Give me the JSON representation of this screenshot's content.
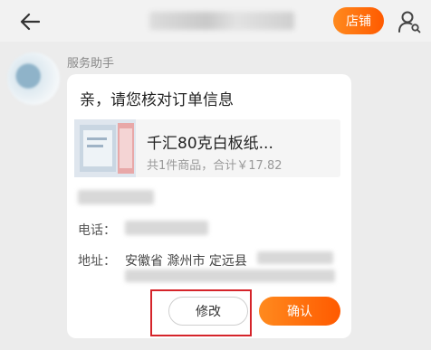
{
  "colors": {
    "accent": "#ff7a1a",
    "accent_gradient_end": "#ff5a00",
    "highlight": "#d5242a"
  },
  "header": {
    "back_icon": "arrow-left-icon",
    "store_button_label": "店铺",
    "user_icon": "user-search-icon"
  },
  "message": {
    "sender": "服务助手",
    "card": {
      "title": "亲，请您核对订单信息",
      "product": {
        "name": "千汇80克白板纸...",
        "summary": "共1件商品，合计￥17.82"
      },
      "phone_label": "电话：",
      "address_label": "地址：",
      "address_visible": "安徽省 滁州市 定远县",
      "modify_label": "修改",
      "confirm_label": "确认"
    }
  }
}
